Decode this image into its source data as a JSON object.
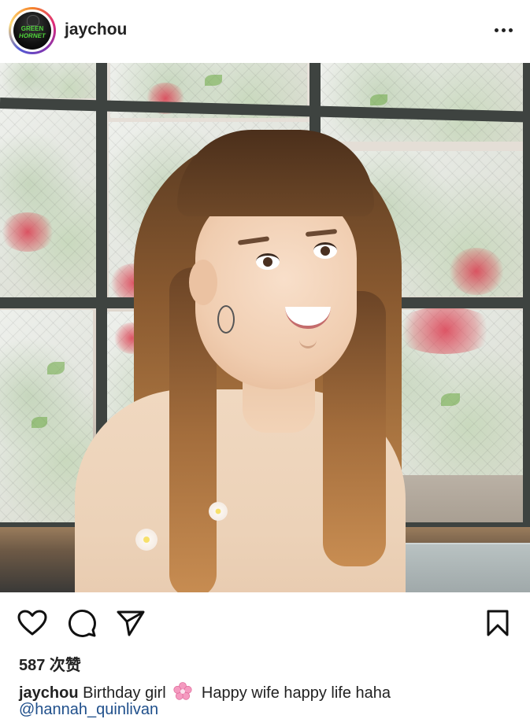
{
  "post": {
    "username": "jaychou",
    "avatar_logo_line1": "GREEN",
    "avatar_logo_line2": "HORNET",
    "more_icon": "more-horizontal-icon",
    "photo_alt": "post-photo",
    "likes_text": "587 次赞",
    "caption_user": "jaychou",
    "caption_text_1": "Birthday girl",
    "caption_emoji": "cherry-blossom-icon",
    "caption_text_2": "Happy wife happy life haha",
    "mention": "@hannah_quinlivan"
  },
  "actions": {
    "like_icon": "heart-icon",
    "comment_icon": "comment-icon",
    "share_icon": "send-icon",
    "save_icon": "bookmark-icon"
  },
  "colors": {
    "text": "#222222",
    "mention": "#1f4f8b",
    "background": "#ffffff"
  }
}
